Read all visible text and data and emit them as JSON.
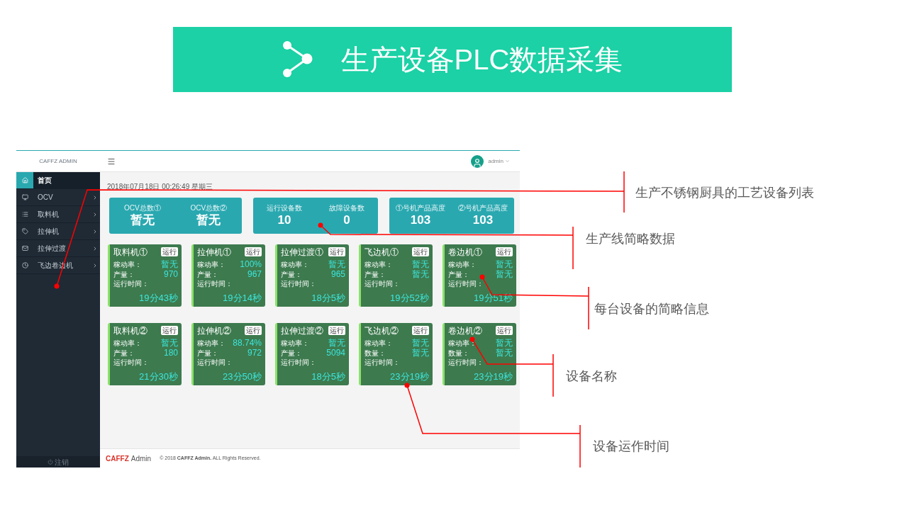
{
  "banner": {
    "title": "生产设备PLC数据采集"
  },
  "header": {
    "brand": "CAFFZ ADMIN",
    "user": "admin"
  },
  "sidebar": {
    "items": [
      {
        "label": "首页",
        "kind": "home",
        "selected": true
      },
      {
        "label": "OCV",
        "kind": "monitor",
        "selected": false
      },
      {
        "label": "取料机",
        "kind": "list",
        "selected": false
      },
      {
        "label": "拉伸机",
        "kind": "tag",
        "selected": false
      },
      {
        "label": "拉伸过渡",
        "kind": "mail",
        "selected": false
      },
      {
        "label": "飞边卷边机",
        "kind": "clock",
        "selected": false
      }
    ],
    "logout": "注销"
  },
  "date": "2018年07月18日 00:26:49 星期三",
  "stat_cards": [
    {
      "stats": [
        {
          "label": "OCV总数①",
          "value": "暂无"
        },
        {
          "label": "OCV总数②",
          "value": "暂无"
        }
      ]
    },
    {
      "stats": [
        {
          "label": "运行设备数",
          "value": "10"
        },
        {
          "label": "故障设备数",
          "value": "0"
        }
      ]
    },
    {
      "stats": [
        {
          "label": "①号机产品高度",
          "value": "103"
        },
        {
          "label": "②号机产品高度",
          "value": "103"
        }
      ]
    }
  ],
  "device_rows": [
    [
      {
        "name": "取料机①",
        "status": "运行",
        "rate_label": "稼动率：",
        "rate": "暂无",
        "output_label": "产量：",
        "output": "970",
        "time_label": "运行时间：",
        "time": "19分43秒"
      },
      {
        "name": "拉伸机①",
        "status": "运行",
        "rate_label": "稼动率：",
        "rate": "100%",
        "output_label": "产量：",
        "output": "967",
        "time_label": "运行时间：",
        "time": "19分14秒"
      },
      {
        "name": "拉伸过渡①",
        "status": "运行",
        "rate_label": "稼动率：",
        "rate": "暂无",
        "output_label": "产量：",
        "output": "965",
        "time_label": "运行时间：",
        "time": "18分5秒"
      },
      {
        "name": "飞边机①",
        "status": "运行",
        "rate_label": "稼动率：",
        "rate": "暂无",
        "output_label": "产量：",
        "output": "暂无",
        "time_label": "运行时间：",
        "time": "19分52秒"
      },
      {
        "name": "卷边机①",
        "status": "运行",
        "rate_label": "稼动率：",
        "rate": "暂无",
        "output_label": "产量：",
        "output": "暂无",
        "time_label": "运行时间：",
        "time": "19分51秒"
      }
    ],
    [
      {
        "name": "取料机②",
        "status": "运行",
        "rate_label": "稼动率：",
        "rate": "暂无",
        "output_label": "产量：",
        "output": "180",
        "time_label": "运行时间：",
        "time": "21分30秒"
      },
      {
        "name": "拉伸机②",
        "status": "运行",
        "rate_label": "稼动率：",
        "rate": "88.74%",
        "output_label": "产量：",
        "output": "972",
        "time_label": "运行时间：",
        "time": "23分50秒"
      },
      {
        "name": "拉伸过渡②",
        "status": "运行",
        "rate_label": "稼动率：",
        "rate": "暂无",
        "output_label": "产量：",
        "output": "5094",
        "time_label": "运行时间：",
        "time": "18分5秒"
      },
      {
        "name": "飞边机②",
        "status": "运行",
        "rate_label": "稼动率：",
        "rate": "暂无",
        "output_label": "数量：",
        "output": "暂无",
        "time_label": "运行时间：",
        "time": "23分19秒"
      },
      {
        "name": "卷边机②",
        "status": "运行",
        "rate_label": "稼动率：",
        "rate": "暂无",
        "output_label": "数量：",
        "output": "暂无",
        "time_label": "运行时间：",
        "time": "23分19秒"
      }
    ]
  ],
  "footer": {
    "brand_mark": "CAFFZ",
    "brand": "Admin",
    "copyright": "© 2018 **CAFFZ Admin.** ALL Rights Reserved."
  },
  "annotations": [
    {
      "text": "生产不锈钢厨具的工艺设备列表"
    },
    {
      "text": "生产线简略数据"
    },
    {
      "text": "每台设备的简略信息"
    },
    {
      "text": "设备名称"
    },
    {
      "text": "设备运作时间"
    }
  ]
}
